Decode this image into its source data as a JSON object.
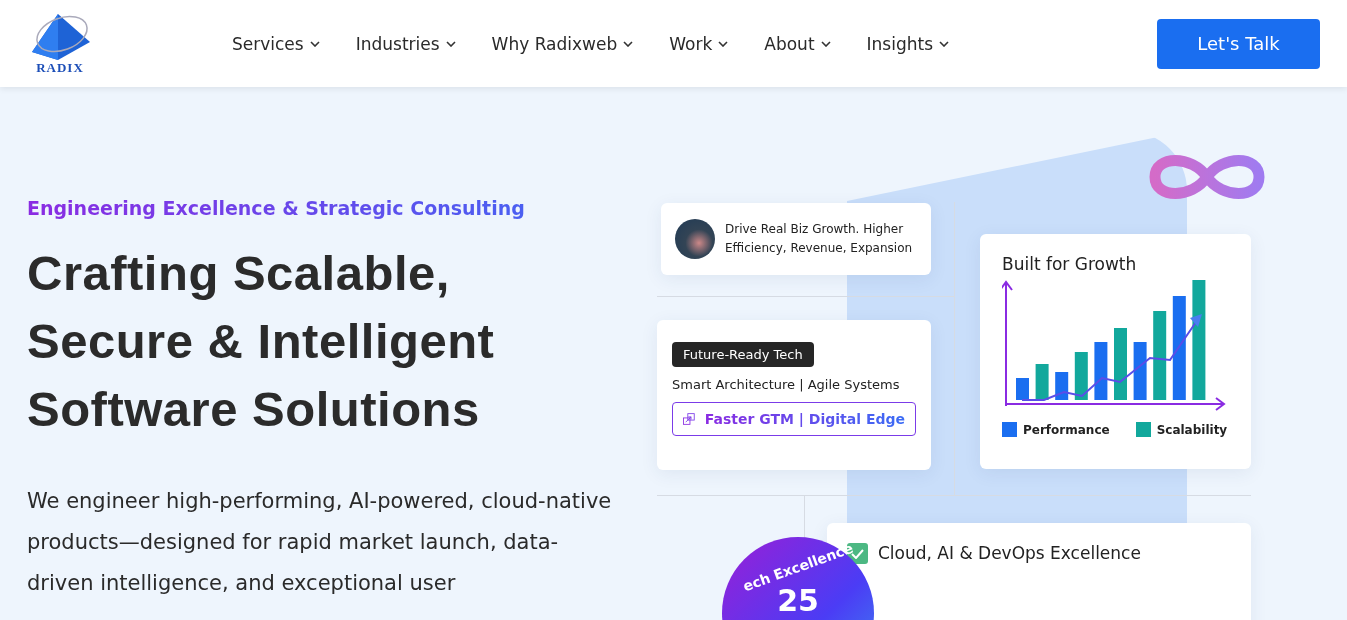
{
  "header": {
    "logo_text": "RADIX",
    "nav": [
      {
        "label": "Services"
      },
      {
        "label": "Industries"
      },
      {
        "label": "Why Radixweb"
      },
      {
        "label": "Work"
      },
      {
        "label": "About"
      },
      {
        "label": "Insights"
      }
    ],
    "cta": "Let's Talk"
  },
  "hero": {
    "eyebrow": "Engineering Excellence & Strategic Consulting",
    "title": [
      "Crafting Scalable,",
      "Secure & Intelligent",
      "Software Solutions"
    ],
    "description": "We engineer high-performing, AI-powered, cloud-native products—designed for rapid market launch, data-driven intelligence, and exceptional user"
  },
  "visual": {
    "growth_card": "Drive Real Biz Growth. Higher Efficiency, Revenue, Expansion",
    "tech_card": {
      "tag": "Future-Ready Tech",
      "subtitle": "Smart Architecture | Agile Systems",
      "highlight": "Faster GTM | Digital Edge"
    },
    "chart_card": {
      "title": "Built for Growth",
      "legend": [
        {
          "label": "Performance",
          "color": "#1a6ef0"
        },
        {
          "label": "Scalability",
          "color": "#12a89c"
        }
      ]
    },
    "excellence_card": {
      "label": "Cloud, AI & DevOps Excellence",
      "checked": true
    },
    "badge": {
      "arc_text": "ech Excellence",
      "number": "25"
    }
  }
}
